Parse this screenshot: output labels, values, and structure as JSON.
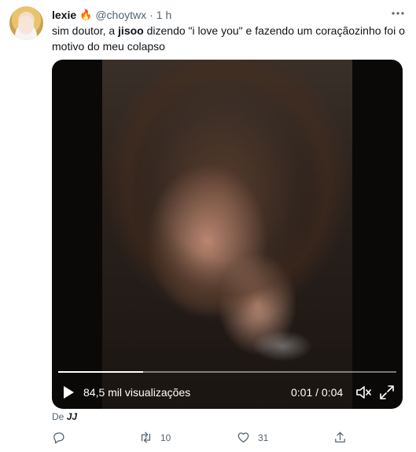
{
  "tweet": {
    "author_name": "lexie",
    "author_emoji": "🔥",
    "author_handle": "@choytwx",
    "separator": "·",
    "time": "1 h",
    "text_before": "sim doutor, a ",
    "text_bold": "jisoo",
    "text_after": " dizendo \"i love you\" e fazendo um coraçãozinho foi o motivo do meu colapso"
  },
  "video": {
    "views": "84,5 mil visualizações",
    "timer": "0:01 / 0:04",
    "progress": 0.25
  },
  "source": {
    "prefix": "De",
    "name": "JJ"
  },
  "actions": {
    "retweet_count": "10",
    "like_count": "31"
  },
  "icons": {
    "more": "more-icon",
    "play": "play-icon",
    "volume": "volume-icon",
    "fullscreen": "fullscreen-icon",
    "reply": "reply-icon",
    "retweet": "retweet-icon",
    "like": "like-icon",
    "share": "share-icon"
  }
}
